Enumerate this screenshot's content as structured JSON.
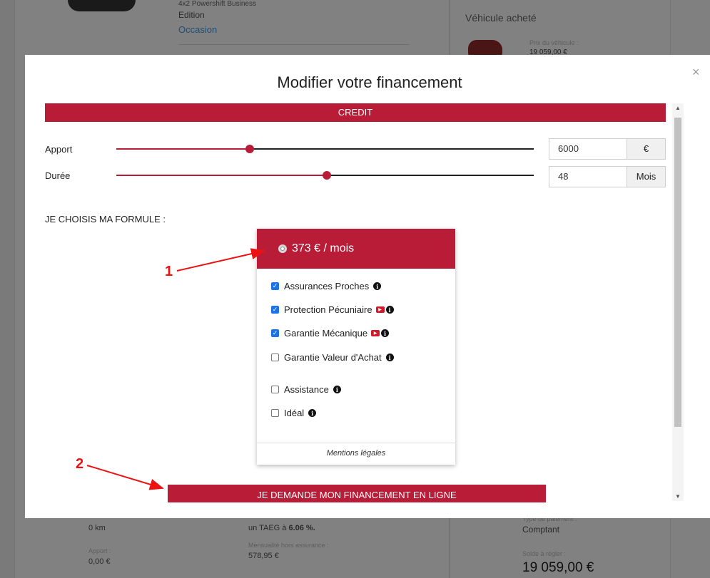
{
  "background": {
    "car_title": "4x2 Powershift Business",
    "car_edition": "Edition",
    "car_condition": "Occasion",
    "vehicle_purchased": "Véhicule acheté",
    "price_label": "Prix du véhicule :",
    "price_value": "19 059,00 €",
    "mileage": "0 km",
    "apport_label": "Apport :",
    "apport_value": "0,00 €",
    "taeg_text": "un TAEG à",
    "taeg_value": "6.06 %.",
    "monthly_label": "Mensualité hors assurance :",
    "monthly_value": "578,95 €",
    "payment_type_label": "Type de paiement :",
    "payment_type_value": "Comptant",
    "balance_label": "Solde à régler :",
    "balance_value": "19 059,00 €"
  },
  "modal": {
    "title": "Modifier votre financement",
    "close_icon": "×",
    "section_title": "CREDIT",
    "apport": {
      "label": "Apport",
      "value": "6000",
      "unit": "€",
      "slider_fraction": 0.32
    },
    "duree": {
      "label": "Durée",
      "value": "48",
      "unit": "Mois",
      "slider_fraction": 0.505
    },
    "formule_label": "JE CHOISIS MA FORMULE :",
    "offer": {
      "price": "373 € / mois",
      "options": [
        {
          "label": "Assurances Proches",
          "checked": true,
          "video": false
        },
        {
          "label": "Protection Pécuniaire",
          "checked": true,
          "video": true
        },
        {
          "label": "Garantie Mécanique",
          "checked": true,
          "video": true
        },
        {
          "label": "Garantie Valeur d'Achat",
          "checked": false,
          "video": false
        },
        {
          "label": "Assistance",
          "checked": false,
          "video": false
        },
        {
          "label": "Idéal",
          "checked": false,
          "video": false
        }
      ],
      "legal": "Mentions légales"
    },
    "cta": "JE DEMANDE MON FINANCEMENT EN LIGNE"
  },
  "annotations": {
    "one": "1",
    "two": "2"
  },
  "colors": {
    "brand": "#b81c37",
    "annotation": "#e11111",
    "checkbox": "#1a73e8"
  }
}
